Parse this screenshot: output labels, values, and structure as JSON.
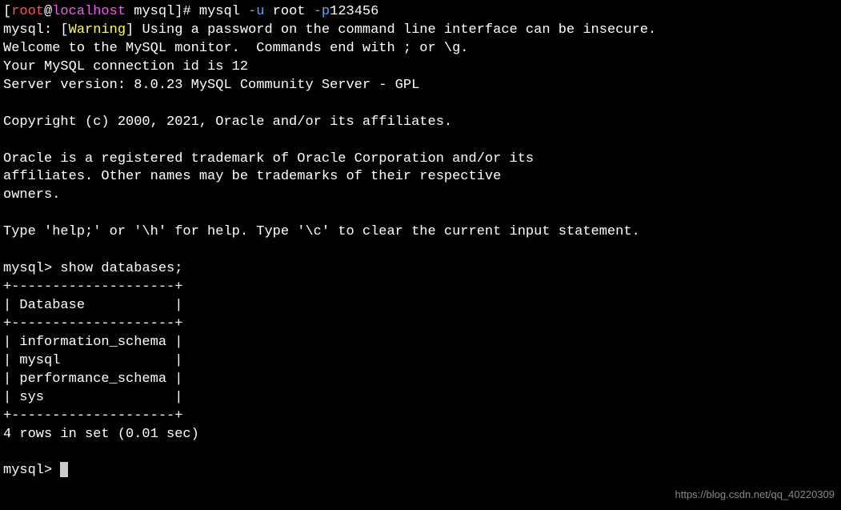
{
  "prompt1": {
    "open": "[",
    "user": "root",
    "at": "@",
    "host": "localhost",
    "space": " ",
    "path": "mysql",
    "close": "]# ",
    "cmd": "mysql",
    "flag1": " -u",
    "arg1": " root",
    "flag2": " -p",
    "arg2": "123456"
  },
  "warn": {
    "prefix": "mysql: [",
    "word": "Warning",
    "suffix": "] Using a password on the command line interface can be insecure."
  },
  "welcome1": "Welcome to the MySQL monitor.  Commands end with ; or \\g.",
  "welcome2": "Your MySQL connection id is 12",
  "welcome3": "Server version: 8.0.23 MySQL Community Server - GPL",
  "copyright": "Copyright (c) 2000, 2021, Oracle and/or its affiliates.",
  "legal1": "Oracle is a registered trademark of Oracle Corporation and/or its",
  "legal2": "affiliates. Other names may be trademarks of their respective",
  "legal3": "owners.",
  "help": "Type 'help;' or '\\h' for help. Type '\\c' to clear the current input statement.",
  "mysqlprompt1": {
    "prompt": "mysql> ",
    "cmd": "show databases;"
  },
  "table": {
    "border": "+--------------------+",
    "header": "| Database           |",
    "row1": "| information_schema |",
    "row2": "| mysql              |",
    "row3": "| performance_schema |",
    "row4": "| sys                |"
  },
  "result": "4 rows in set (0.01 sec)",
  "mysqlprompt2": "mysql> ",
  "watermark": "https://blog.csdn.net/qq_40220309"
}
